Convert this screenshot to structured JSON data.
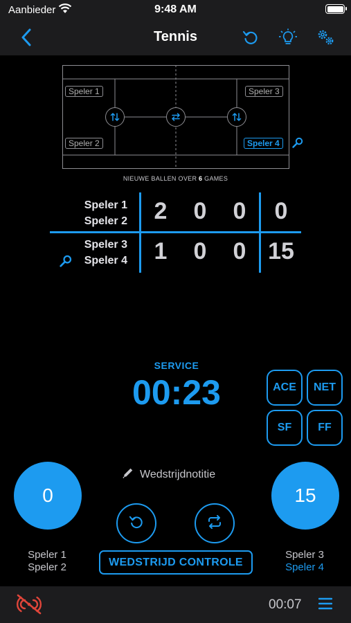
{
  "status_bar": {
    "carrier": "Aanbieder",
    "time": "9:48 AM"
  },
  "nav": {
    "title": "Tennis",
    "back_icon": "chevron-left-icon",
    "undo_icon": "undo-icon",
    "tips_icon": "lightbulb-icon",
    "settings_icon": "gears-icon"
  },
  "court": {
    "players": {
      "top_left": "Speler 1",
      "bottom_left": "Speler 2",
      "top_right": "Speler 3",
      "bottom_right": "Speler 4"
    },
    "server": "Speler 4",
    "new_balls_prefix": "NIEUWE BALLEN OVER ",
    "new_balls_count": "6",
    "new_balls_suffix": " GAMES"
  },
  "scoreboard": {
    "teams": [
      {
        "player1": "Speler 1",
        "player2": "Speler 2",
        "sets": [
          "2",
          "0",
          "0"
        ],
        "points": "0",
        "serving": false
      },
      {
        "player1": "Speler 3",
        "player2": "Speler 4",
        "sets": [
          "1",
          "0",
          "0"
        ],
        "points": "15",
        "serving": true
      }
    ]
  },
  "service": {
    "label": "SERVICE",
    "timer": "00:23"
  },
  "point_buttons": [
    "ACE",
    "NET",
    "SF",
    "FF"
  ],
  "match_note": "Wedstrijdnotitie",
  "left_score": "0",
  "right_score": "15",
  "left_team": {
    "player1": "Speler 1",
    "player2": "Speler 2"
  },
  "right_team": {
    "player1": "Speler 3",
    "player2": "Speler 4"
  },
  "match_control_label": "WEDSTRIJD CONTROLE",
  "bottom_bar": {
    "elapsed": "00:07"
  },
  "colors": {
    "accent": "#1d9bf0",
    "warning": "#e0453a",
    "bar": "#1c1c1e"
  }
}
